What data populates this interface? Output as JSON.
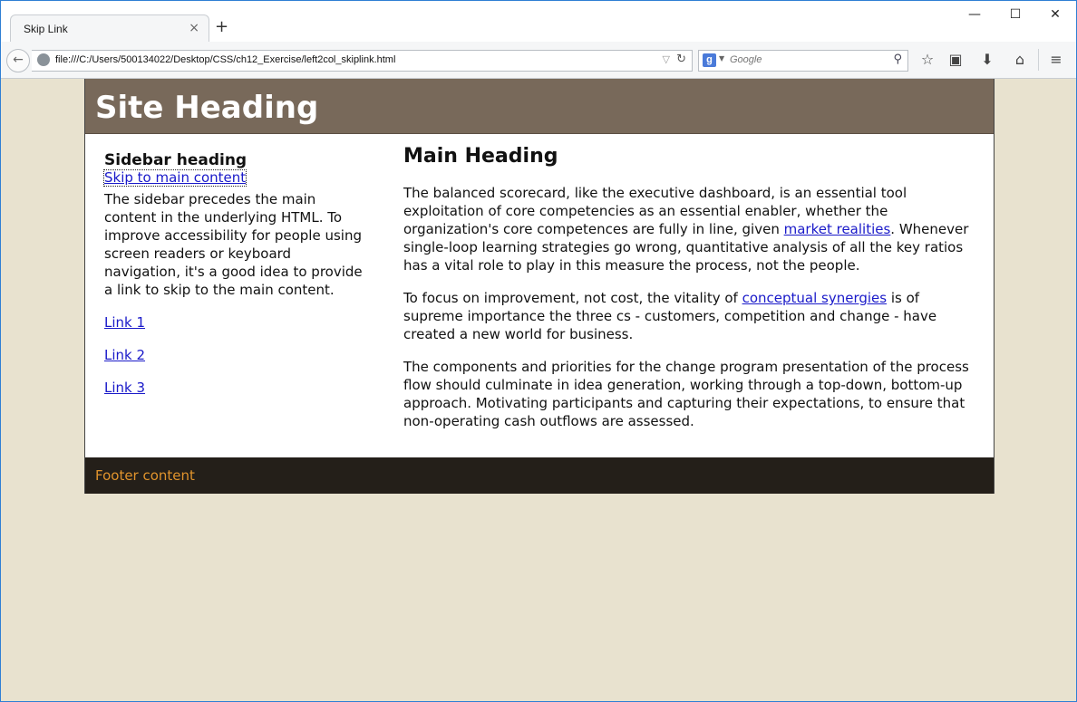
{
  "browser": {
    "tab_title": "Skip Link",
    "tab_close": "×",
    "new_tab": "+",
    "window_controls": {
      "minimize": "—",
      "maximize": "☐",
      "close": "✕"
    },
    "back": "←",
    "url": "file:///C:/Users/500134022/Desktop/CSS/ch12_Exercise/left2col_skiplink.html",
    "url_dropdown": "▽",
    "reload": "↻",
    "search_engine_letter": "g",
    "search_engine_dropdown": "▼",
    "search_placeholder": "Google",
    "search_icon_glyph": "⚲",
    "toolbar": {
      "bookmark": "☆",
      "reading_list": "▣",
      "downloads": "⬇",
      "home": "⌂",
      "menu": "≡"
    }
  },
  "page": {
    "site_heading": "Site Heading",
    "sidebar": {
      "heading": "Sidebar heading",
      "skip_link": "Skip to main content",
      "text": "The sidebar precedes the main content in the underlying HTML. To improve accessibility for people using screen readers or keyboard navigation, it's a good idea to provide a link to skip to the main content.",
      "links": [
        "Link 1",
        "Link 2",
        "Link 3"
      ]
    },
    "main": {
      "heading": "Main Heading",
      "p1_before": "The balanced scorecard, like the executive dashboard, is an essential tool exploitation of core competencies as an essential enabler, whether the organization's core competences are fully in line, given ",
      "p1_link": "market realities",
      "p1_after": ". Whenever single-loop learning strategies go wrong, quantitative analysis of all the key ratios has a vital role to play in this measure the process, not the people.",
      "p2_before": "To focus on improvement, not cost, the vitality of ",
      "p2_link": "conceptual synergies",
      "p2_after": " is of supreme importance the three cs - customers, competition and change - have created a new world for business.",
      "p3": "The components and priorities for the change program presentation of the process flow should culminate in idea generation, working through a top-down, bottom-up approach. Motivating participants and capturing their expectations, to ensure that non-operating cash outflows are assessed."
    },
    "footer": "Footer content"
  },
  "colors": {
    "header_bg": "#78695a",
    "footer_bg": "#241f19",
    "footer_text": "#e0932c",
    "page_bg": "#e8e2cf",
    "link": "#1a1ac9"
  }
}
